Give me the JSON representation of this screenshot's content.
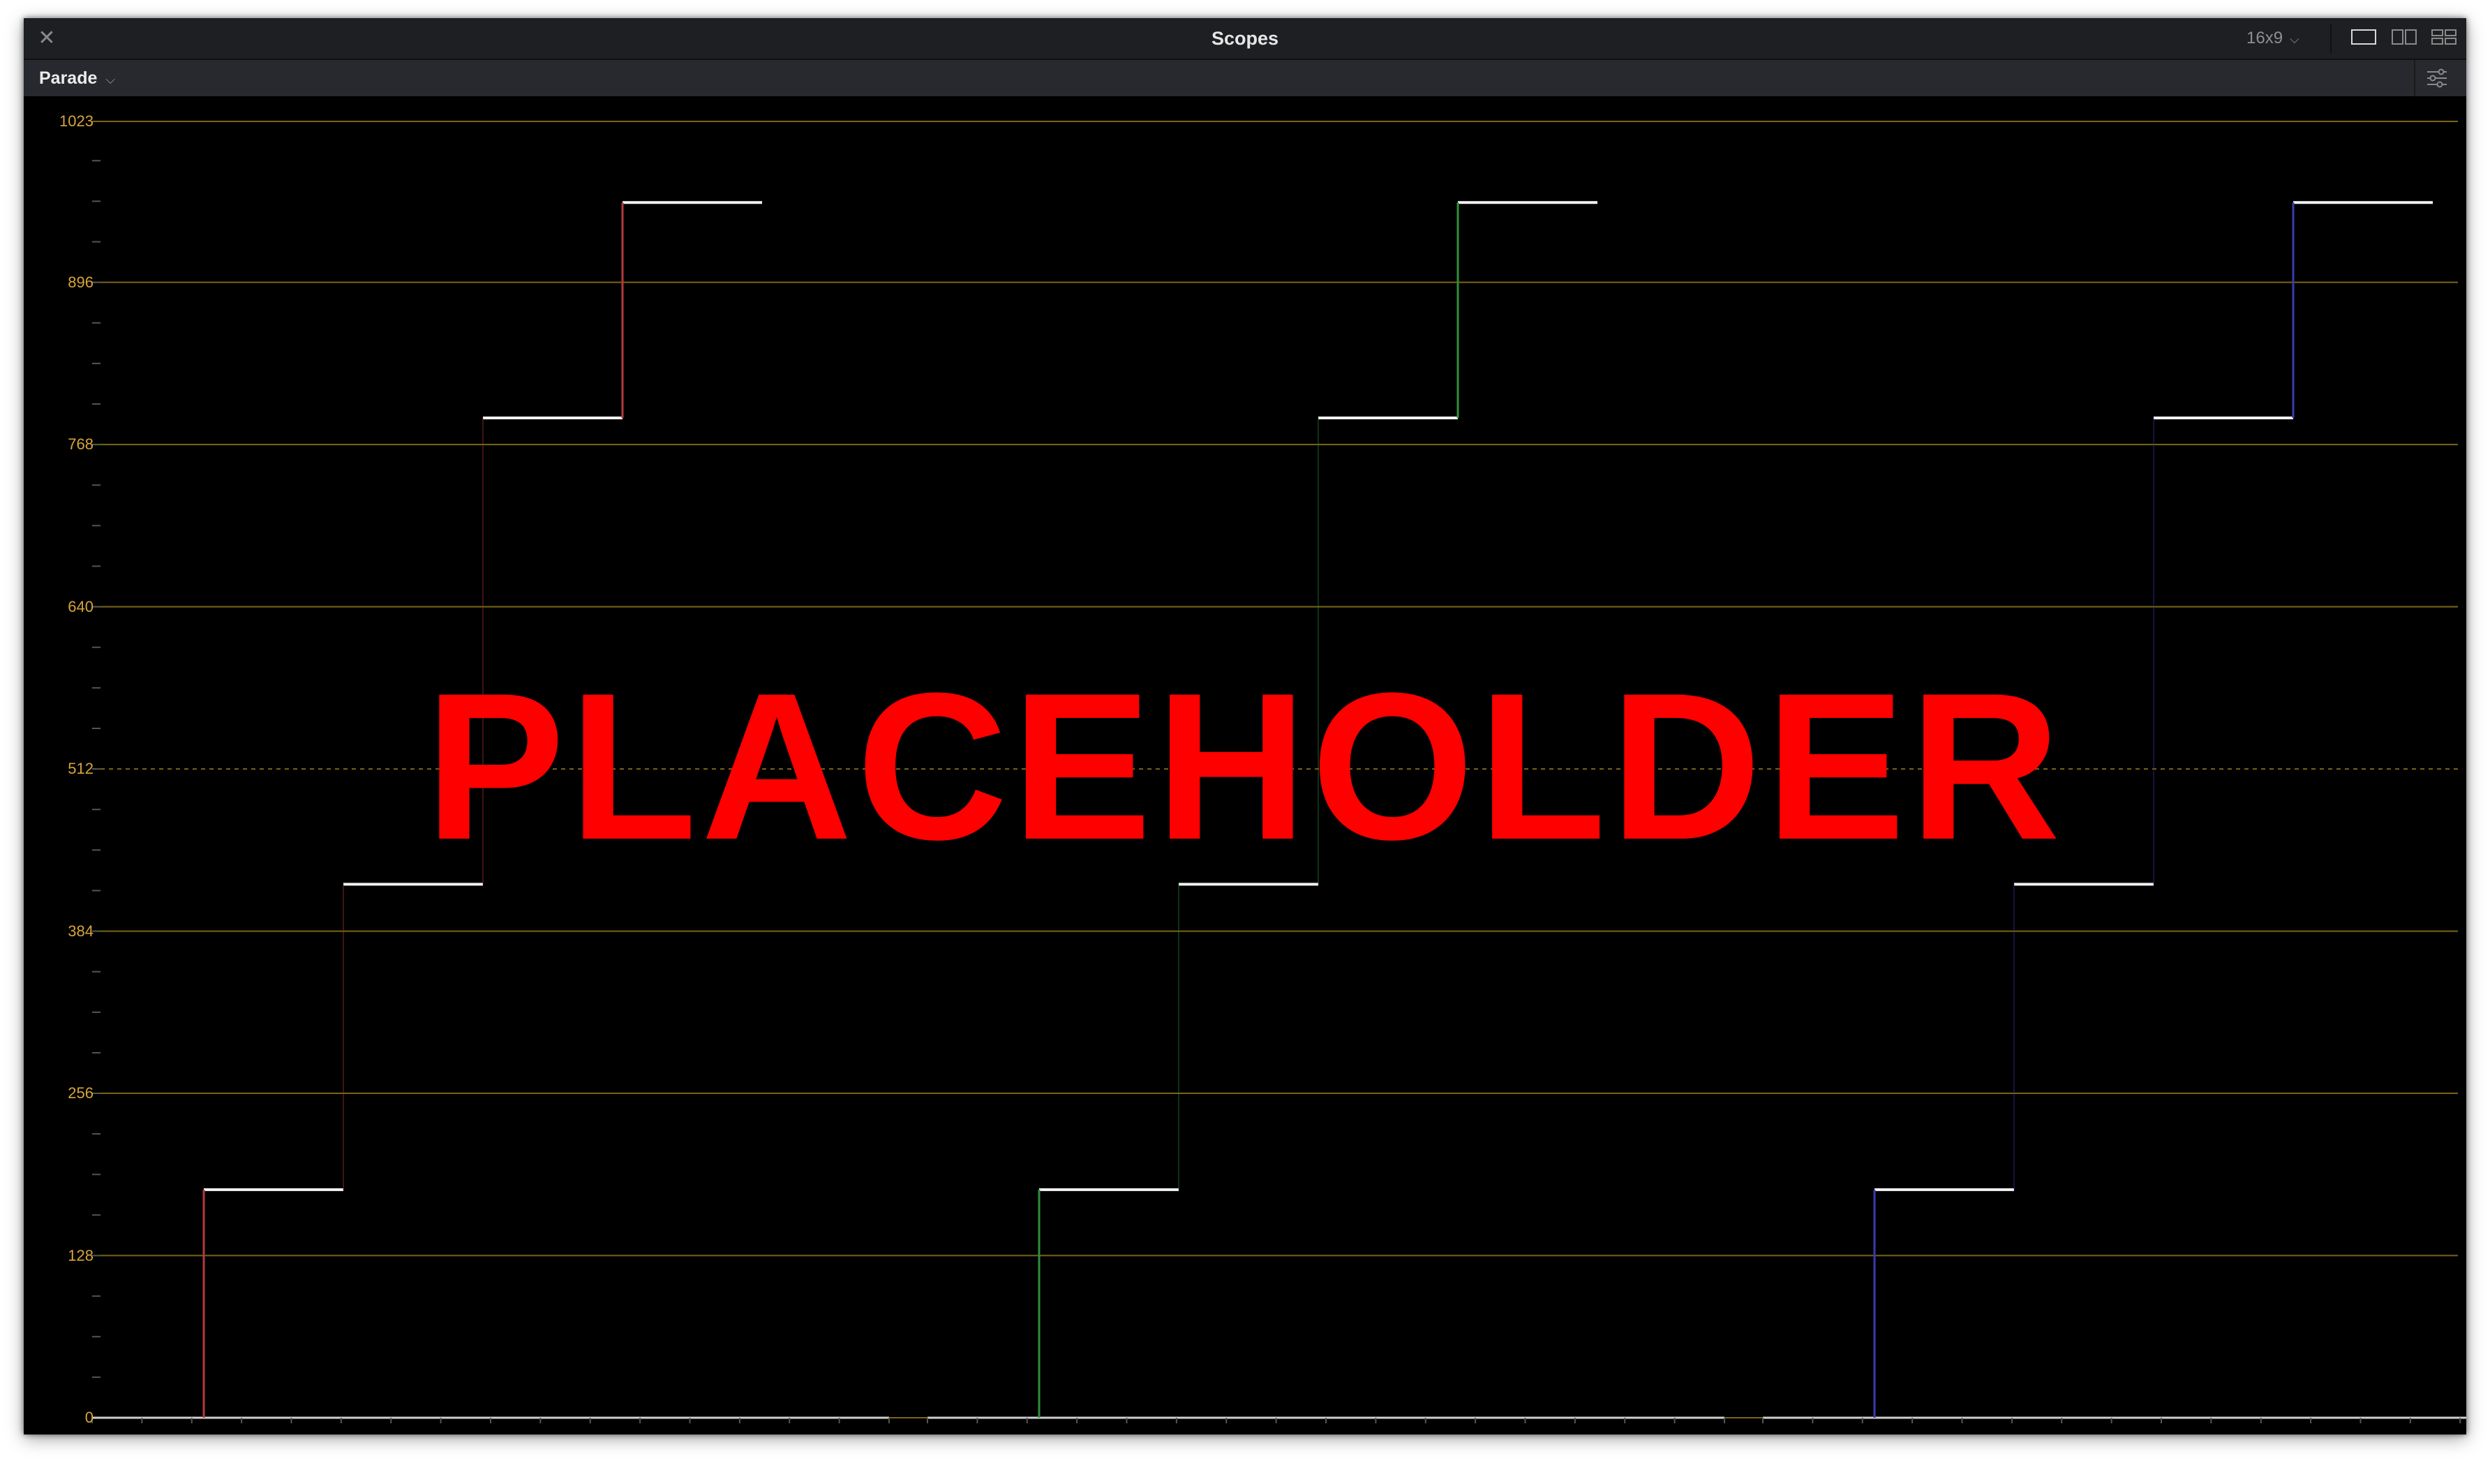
{
  "window": {
    "title": "Scopes",
    "aspect_label": "16x9"
  },
  "toolbar": {
    "mode_label": "Parade"
  },
  "scope": {
    "axis_labels": [
      "1023",
      "896",
      "768",
      "640",
      "512",
      "384",
      "256",
      "128",
      "0"
    ],
    "overlay_text": "PLACEHOLDER",
    "channels": [
      {
        "name": "red",
        "color": "#b33a3a"
      },
      {
        "name": "green",
        "color": "#2f8f3a"
      },
      {
        "name": "blue",
        "color": "#3a3ab0"
      }
    ],
    "step_levels": [
      0,
      180,
      421,
      789,
      959
    ],
    "grid_color": "#7a6518",
    "label_color": "#d7a53a"
  },
  "icons": {
    "close": "close-icon",
    "single_view": "single-view-icon",
    "dual_view": "dual-view-icon",
    "quad_view": "quad-view-icon",
    "settings": "sliders-icon",
    "chevron": "chevron-down-icon"
  }
}
